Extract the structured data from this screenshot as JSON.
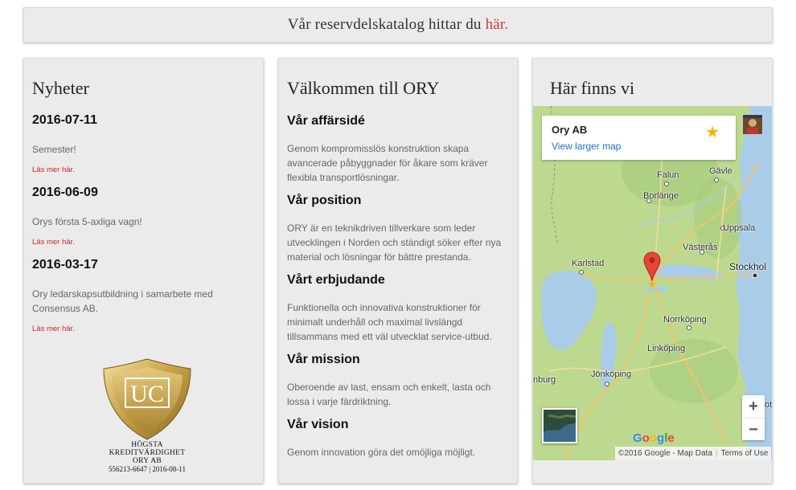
{
  "banner": {
    "text": "Vår reservdelskatalog hittar du ",
    "link": "här."
  },
  "news": {
    "title": "Nyheter",
    "more_label": "Läs mer här.",
    "items": [
      {
        "date": "2016-07-11",
        "text": "Semester!"
      },
      {
        "date": "2016-06-09",
        "text": "Orys första 5-axliga vagn!"
      },
      {
        "date": "2016-03-17",
        "text": "Ory ledarskapsutbildning i samarbete med Consensus AB."
      }
    ],
    "badge": {
      "letters": "UC",
      "line1": "HÖGSTA",
      "line2": "KREDITVÄRDIGHET",
      "line3": "ORY AB",
      "line4": "556213-6647 | 2016-08-11"
    }
  },
  "welcome": {
    "title": "Välkommen till ORY",
    "sections": [
      {
        "heading": "Vår affärsidé",
        "text": "Genom kompromisslös konstruktion skapa avancerade påbyggnader för åkare som kräver flexibla transportlösningar."
      },
      {
        "heading": "Vår position",
        "text": "ORY är en teknikdriven tillverkare som leder utvecklingen i Norden och ständigt söker efter nya material och lösningar för bättre prestanda."
      },
      {
        "heading": "Vårt erbjudande",
        "text": "Funktionella och innovativa konstruktioner för minimalt underhåll och maximal livslängd tillsammans med ett väl utvecklat service-utbud."
      },
      {
        "heading": "Vår mission",
        "text": "Oberoende av last, ensam och enkelt, lasta och lossa i varje färdriktning."
      },
      {
        "heading": "Vår vision",
        "text": "Genom innovation göra det omöjliga möjligt."
      }
    ]
  },
  "location": {
    "title": "Här finns vi",
    "map": {
      "place_name": "Ory AB",
      "view_larger": "View larger map",
      "zoom_in": "+",
      "zoom_out": "−",
      "google": "Google",
      "attribution": "©2016 Google - Map Data",
      "terms": "Terms of Use",
      "labels": {
        "falun": "Falun",
        "gavle": "Gävle",
        "borlange": "Borlänge",
        "uppsala": "Uppsala",
        "vasteras": "Västerås",
        "karlstad": "Karlstad",
        "stockholm": "Stockhol",
        "norrkoping": "Norrköping",
        "linkoping": "Linköping",
        "jonkoping": "Jönköping",
        "goteborg": "nburg",
        "edge": "otl"
      }
    }
  }
}
